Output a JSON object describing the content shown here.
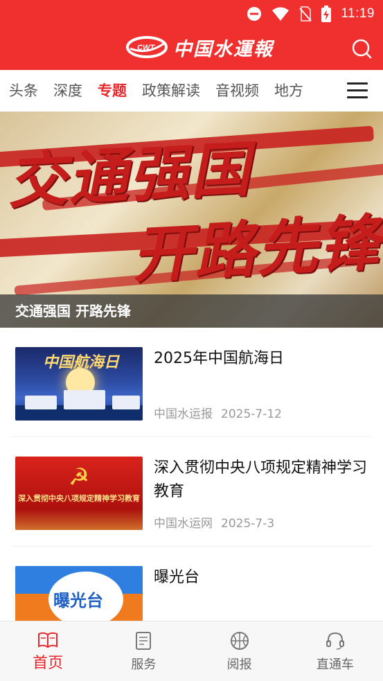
{
  "status_bar": {
    "time": "11:19",
    "icons": [
      "do-not-disturb-icon",
      "wifi-icon",
      "no-sim-icon",
      "battery-charging-icon"
    ]
  },
  "header": {
    "logo_badge": "CWT",
    "logo_text": "中国水運報",
    "brand_color": "#f0302f",
    "search_icon": "search-icon"
  },
  "tabs": {
    "items": [
      {
        "label": "头条"
      },
      {
        "label": "深度"
      },
      {
        "label": "专题"
      },
      {
        "label": "政策解读"
      },
      {
        "label": "音视频"
      },
      {
        "label": "地方"
      }
    ],
    "active_index": 2,
    "active_color": "#e8262b",
    "menu_icon": "hamburger-menu-icon"
  },
  "banner": {
    "slogan_line1": "交通强国",
    "slogan_line2": "开路先锋",
    "caption": "交通强国  开路先锋"
  },
  "news": [
    {
      "title": "2025年中国航海日",
      "source": "中国水运报",
      "date": "2025-7-12",
      "thumb_text": "中国航海日"
    },
    {
      "title": "深入贯彻中央八项规定精神学习教育",
      "source": "中国水运网",
      "date": "2025-7-3",
      "thumb_text": "深入贯彻中央八项规定精神学习教育"
    },
    {
      "title": "曝光台",
      "source": "",
      "date": "",
      "thumb_text": "曝光台"
    }
  ],
  "bottom_nav": {
    "items": [
      {
        "label": "首页",
        "icon": "book-icon"
      },
      {
        "label": "服务",
        "icon": "document-icon"
      },
      {
        "label": "阅报",
        "icon": "basketball-icon"
      },
      {
        "label": "直通车",
        "icon": "headset-icon"
      }
    ],
    "active_index": 0
  }
}
